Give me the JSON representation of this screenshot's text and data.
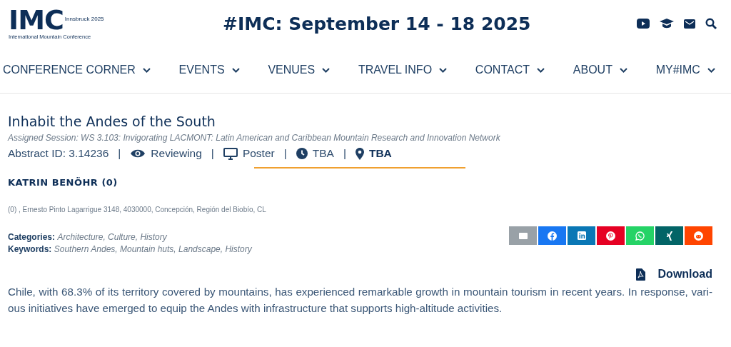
{
  "logo": {
    "letters": "IMC",
    "place": "Innsbruck 2025",
    "name": "International Mountain Conference"
  },
  "header": {
    "title": "#IMC: September 14 - 18 2025",
    "icons": [
      {
        "kind": "youtube"
      },
      {
        "kind": "graduation"
      },
      {
        "kind": "mail"
      },
      {
        "kind": "search"
      }
    ]
  },
  "nav": [
    {
      "label": "CONFERENCE CORNER"
    },
    {
      "label": "EVENTS"
    },
    {
      "label": "VENUES"
    },
    {
      "label": "TRAVEL INFO"
    },
    {
      "label": "CONTACT"
    },
    {
      "label": "ABOUT"
    },
    {
      "label": "MY#IMC"
    }
  ],
  "abstract": {
    "title": "Inhabit the Andes of the South",
    "session": "Assigned Session: WS 3.103: Invigorating LACMONT: Latin American and Caribbean Mountain Research and Innovation Network",
    "meta": [
      {
        "kind": "text",
        "label": "Abstract ID: 3.14236",
        "bold": false
      },
      {
        "separator": "|",
        "kind": "eye",
        "label": "Reviewing",
        "bold": false
      },
      {
        "separator": "|",
        "kind": "monitor",
        "label": "Poster",
        "bold": false
      },
      {
        "separator": "|",
        "kind": "clock",
        "label": "TBA",
        "bold": false
      },
      {
        "separator": "|",
        "kind": "pin",
        "label": "TBA",
        "bold": true
      }
    ],
    "author": "KATRIN BENÖHR (0)",
    "affiliation": "(0) , Ernesto Pinto Lagarrigue 3148, 4030000, Concepción, Región del Biobío, CL",
    "categories": {
      "label": "Categories:",
      "value": "Architecture, Culture, History"
    },
    "keywords": {
      "label": "Keywords:",
      "value": "Southern Andes, Mountain huts, Landscape, History"
    },
    "share": [
      {
        "kind": "email",
        "color": "#99a1a7"
      },
      {
        "kind": "facebook",
        "color": "#1877f2"
      },
      {
        "kind": "linkedin",
        "color": "#0a77b5"
      },
      {
        "kind": "pinterest",
        "color": "#e60023"
      },
      {
        "kind": "whatsapp",
        "color": "#25d366"
      },
      {
        "kind": "xing",
        "color": "#026466"
      },
      {
        "kind": "reddit",
        "color": "#ff4500"
      }
    ],
    "download": "Download",
    "body": "Chile, with 68.3% of its territory covered by mountains, has experienced remarkable growth in mountain tourism in recent years. In response, vari- ous initiatives have emerged to equip the Andes with infrastructure that supports high-altitude activities."
  }
}
